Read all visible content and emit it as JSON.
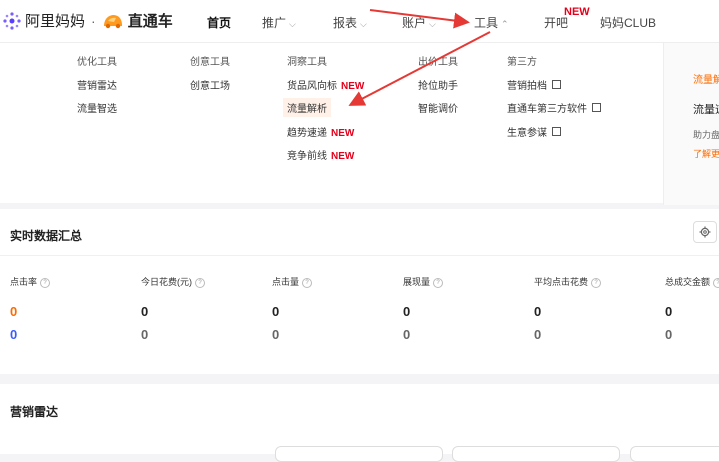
{
  "header": {
    "brand": "阿里妈妈",
    "separator": "·",
    "product": "直通车",
    "nav": [
      {
        "label": "首页",
        "active": true,
        "chevron": false
      },
      {
        "label": "推广",
        "active": false,
        "chevron": true
      },
      {
        "label": "报表",
        "active": false,
        "chevron": true
      },
      {
        "label": "账户",
        "active": false,
        "chevron": true
      },
      {
        "label": "工具",
        "active": false,
        "chevron": true
      },
      {
        "label": "开吧",
        "active": false,
        "chevron": false
      },
      {
        "label": "妈妈CLUB",
        "active": false,
        "chevron": false
      }
    ],
    "new_badge": "NEW"
  },
  "tools_menu": {
    "col1": [
      "优化工具",
      "营销雷达",
      "流量智选"
    ],
    "col2": [
      "创意工具",
      "创意工场"
    ],
    "col3": [
      {
        "label": "洞察工具",
        "new": ""
      },
      {
        "label": "货品风向标",
        "new": "NEW"
      },
      {
        "label": "流量解析",
        "new": ""
      },
      {
        "label": "趋势速递",
        "new": "NEW"
      },
      {
        "label": "竞争前线",
        "new": "NEW"
      }
    ],
    "col4": [
      "出价工具",
      "抢位助手",
      "智能调价"
    ],
    "col5": [
      {
        "label": "第三方",
        "external": false
      },
      {
        "label": "营销拍档",
        "external": true
      },
      {
        "label": "直通车第三方软件",
        "external": true
      },
      {
        "label": "生意参谋",
        "external": true
      }
    ]
  },
  "side_panel": {
    "tab": "流量解析",
    "title": "流量速览",
    "desc": "助力盘点流量",
    "link": "了解更多"
  },
  "realtime": {
    "title": "实时数据汇总",
    "qmark": "?",
    "metrics": [
      {
        "label": "点击率",
        "today": "0",
        "yesterday": "0"
      },
      {
        "label": "今日花费(元)",
        "today": "0",
        "yesterday": "0"
      },
      {
        "label": "点击量",
        "today": "0",
        "yesterday": "0"
      },
      {
        "label": "展现量",
        "today": "0",
        "yesterday": "0"
      },
      {
        "label": "平均点击花费",
        "today": "0",
        "yesterday": "0"
      },
      {
        "label": "总成交金额",
        "today": "0",
        "yesterday": "0"
      }
    ]
  },
  "radar": {
    "title": "营销雷达"
  },
  "colors": {
    "accent": "#ff6a00",
    "new_red": "#e4001b",
    "blue": "#3a5bff",
    "arrow_red": "#e53935"
  }
}
